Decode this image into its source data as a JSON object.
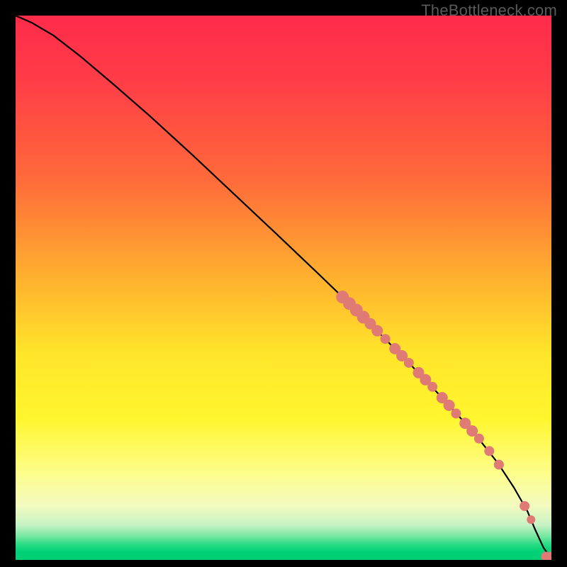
{
  "watermark": "TheBottleneck.com",
  "chart_data": {
    "type": "line",
    "title": "",
    "xlabel": "",
    "ylabel": "",
    "xlim": [
      0,
      100
    ],
    "ylim": [
      0,
      100
    ],
    "gradient_stops": [
      {
        "offset": 0.0,
        "color": "#ff2b4b"
      },
      {
        "offset": 0.12,
        "color": "#ff3d47"
      },
      {
        "offset": 0.3,
        "color": "#ff6a3a"
      },
      {
        "offset": 0.48,
        "color": "#ffb02f"
      },
      {
        "offset": 0.62,
        "color": "#ffe52a"
      },
      {
        "offset": 0.74,
        "color": "#fff62e"
      },
      {
        "offset": 0.84,
        "color": "#fdfd8a"
      },
      {
        "offset": 0.9,
        "color": "#f3fabf"
      },
      {
        "offset": 0.935,
        "color": "#c9f3c4"
      },
      {
        "offset": 0.955,
        "color": "#7de8a3"
      },
      {
        "offset": 0.972,
        "color": "#28db85"
      },
      {
        "offset": 0.985,
        "color": "#00d176"
      },
      {
        "offset": 1.0,
        "color": "#00cf74"
      }
    ],
    "series": [
      {
        "name": "curve",
        "color": "#000000",
        "width": 2.2,
        "x": [
          0,
          3,
          7,
          12,
          18,
          25,
          33,
          41,
          49,
          57,
          65,
          73,
          80,
          86,
          90,
          93,
          95.5,
          97,
          98.5,
          100
        ],
        "y": [
          100,
          98.7,
          96.4,
          92.6,
          87.6,
          81.6,
          74.4,
          67.0,
          59.6,
          52.1,
          44.5,
          36.6,
          29.4,
          22.8,
          17.8,
          13.3,
          9.0,
          5.5,
          2.3,
          0.2
        ]
      }
    ],
    "markers": {
      "color": "#df7b74",
      "radius_default": 7,
      "points": [
        {
          "x": 61.0,
          "y": 48.3,
          "r": 9
        },
        {
          "x": 62.3,
          "y": 47.1,
          "r": 9
        },
        {
          "x": 63.6,
          "y": 45.9,
          "r": 9
        },
        {
          "x": 64.9,
          "y": 44.6,
          "r": 9
        },
        {
          "x": 66.2,
          "y": 43.4,
          "r": 8
        },
        {
          "x": 67.5,
          "y": 42.1,
          "r": 8
        },
        {
          "x": 69.0,
          "y": 40.6,
          "r": 7
        },
        {
          "x": 70.8,
          "y": 38.8,
          "r": 8
        },
        {
          "x": 72.1,
          "y": 37.5,
          "r": 8
        },
        {
          "x": 73.4,
          "y": 36.2,
          "r": 7
        },
        {
          "x": 75.2,
          "y": 34.4,
          "r": 8
        },
        {
          "x": 76.5,
          "y": 33.1,
          "r": 8
        },
        {
          "x": 77.8,
          "y": 31.8,
          "r": 7
        },
        {
          "x": 79.6,
          "y": 29.8,
          "r": 8
        },
        {
          "x": 80.9,
          "y": 28.4,
          "r": 8
        },
        {
          "x": 82.2,
          "y": 26.9,
          "r": 7
        },
        {
          "x": 83.9,
          "y": 25.1,
          "r": 8
        },
        {
          "x": 85.2,
          "y": 23.7,
          "r": 8
        },
        {
          "x": 86.5,
          "y": 22.3,
          "r": 7
        },
        {
          "x": 88.4,
          "y": 20.0,
          "r": 7
        },
        {
          "x": 90.2,
          "y": 17.5,
          "r": 7
        },
        {
          "x": 95.0,
          "y": 9.9,
          "r": 7
        },
        {
          "x": 96.2,
          "y": 7.4,
          "r": 6
        },
        {
          "x": 99.0,
          "y": 0.6,
          "r": 7
        },
        {
          "x": 100.0,
          "y": 0.6,
          "r": 7
        }
      ]
    }
  }
}
